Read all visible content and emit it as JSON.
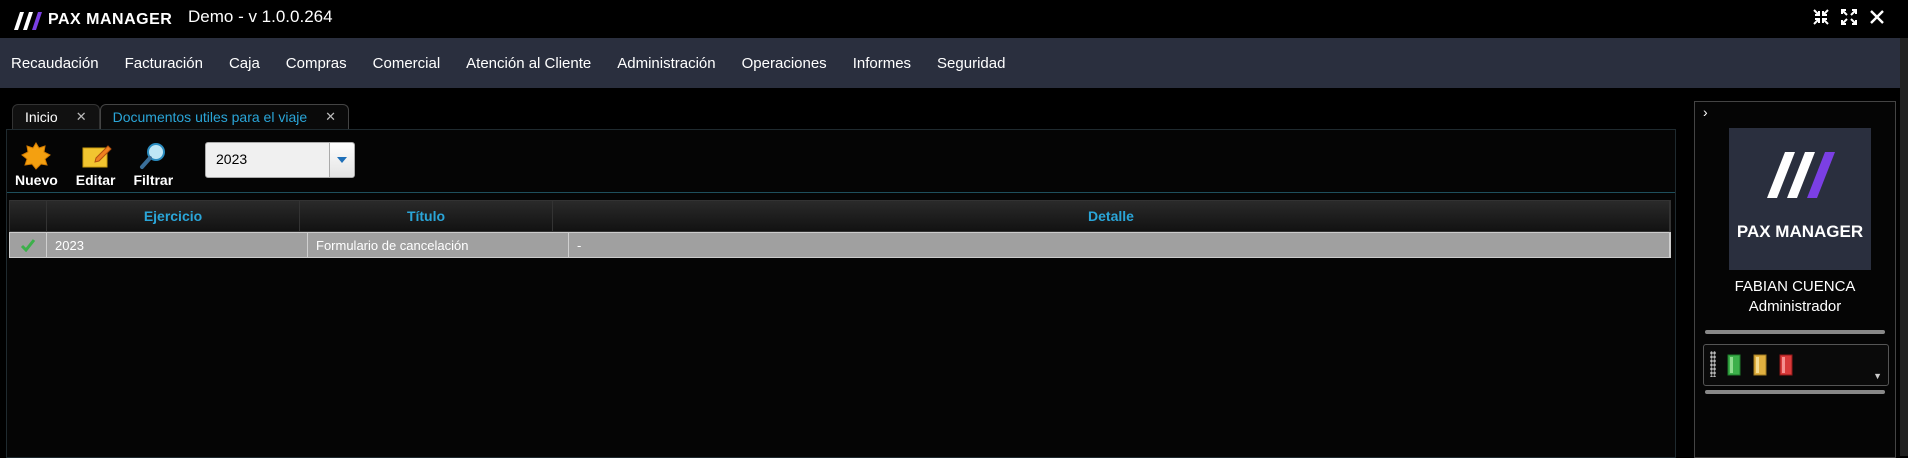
{
  "app": {
    "logo_text": "PAX MANAGER",
    "title": "Demo - v 1.0.0.264"
  },
  "menu": {
    "items": [
      "Recaudación",
      "Facturación",
      "Caja",
      "Compras",
      "Comercial",
      "Atención al Cliente",
      "Administración",
      "Operaciones",
      "Informes",
      "Seguridad"
    ]
  },
  "tabs": [
    {
      "label": "Inicio",
      "active": false
    },
    {
      "label": "Documentos utiles para el viaje",
      "active": true
    }
  ],
  "toolbar": {
    "new_label": "Nuevo",
    "edit_label": "Editar",
    "filter_label": "Filtrar",
    "year_select": "2023"
  },
  "grid": {
    "columns": [
      "Ejercicio",
      "Título",
      "Detalle"
    ],
    "rows": [
      {
        "ejercicio": "2023",
        "titulo": "Formulario de cancelación",
        "detalle": "-"
      }
    ]
  },
  "user": {
    "logo_text": "PAX MANAGER",
    "name": "FABIAN CUENCA",
    "role": "Administrador"
  },
  "colors": {
    "accent": "#2aa5d8",
    "menu_bg": "#2a2f3e",
    "row_bg": "#a0a0a0",
    "brand_purple": "#7b3fe4"
  }
}
